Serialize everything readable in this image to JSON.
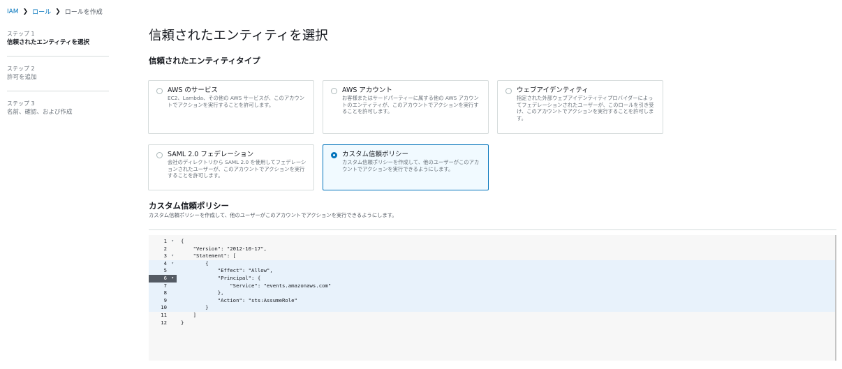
{
  "breadcrumb": {
    "items": [
      "IAM",
      "ロール",
      "ロールを作成"
    ]
  },
  "steps": [
    {
      "num": "ステップ 1",
      "title": "信頼されたエンティティを選択"
    },
    {
      "num": "ステップ 2",
      "title": "許可を追加"
    },
    {
      "num": "ステップ 3",
      "title": "名前、確認、および作成"
    }
  ],
  "page_title": "信頼されたエンティティを選択",
  "entity_type": {
    "heading": "信頼されたエンティティタイプ",
    "options": [
      {
        "title": "AWS のサービス",
        "desc": "EC2、Lambda、その他の AWS サービスが、このアカウントでアクションを実行することを許可します。",
        "selected": false
      },
      {
        "title": "AWS アカウント",
        "desc": "お客様またはサードパーティーに属する他の AWS アカウントのエンティティが、このアカウントでアクションを実行することを許可します。",
        "selected": false
      },
      {
        "title": "ウェブアイデンティティ",
        "desc": "指定された外部ウェブアイデンティティプロバイダーによってフェデレーションされたユーザーが、このロールを引き受け、このアカウントでアクションを実行することを許可します。",
        "selected": false
      },
      {
        "title": "SAML 2.0 フェデレーション",
        "desc": "会社のディレクトリから SAML 2.0 を使用してフェデレーションされたユーザーが、このアカウントでアクションを実行することを許可します。",
        "selected": false
      },
      {
        "title": "カスタム信頼ポリシー",
        "desc": "カスタム信頼ポリシーを作成して、他のユーザーがこのアカウントでアクションを実行できるようにします。",
        "selected": true
      }
    ]
  },
  "custom_policy": {
    "heading": "カスタム信頼ポリシー",
    "desc": "カスタム信頼ポリシーを作成して、他のユーザーがこのアカウントでアクションを実行できるようにします。"
  },
  "editor": {
    "active_line": 6,
    "lines": [
      {
        "n": "1",
        "fold": true,
        "text": "{"
      },
      {
        "n": "2",
        "fold": false,
        "text": "    \"Version\": \"2012-10-17\","
      },
      {
        "n": "3",
        "fold": true,
        "text": "    \"Statement\": ["
      },
      {
        "n": "4",
        "fold": true,
        "text": "        {"
      },
      {
        "n": "5",
        "fold": false,
        "text": "            \"Effect\": \"Allow\","
      },
      {
        "n": "6",
        "fold": true,
        "text": "            \"Principal\": {"
      },
      {
        "n": "7",
        "fold": false,
        "text": "                \"Service\": \"events.amazonaws.com\""
      },
      {
        "n": "8",
        "fold": false,
        "text": "            },"
      },
      {
        "n": "9",
        "fold": false,
        "text": "            \"Action\": \"sts:AssumeRole\""
      },
      {
        "n": "10",
        "fold": false,
        "text": "        }"
      },
      {
        "n": "11",
        "fold": false,
        "text": "    ]"
      },
      {
        "n": "12",
        "fold": false,
        "text": "}"
      }
    ]
  },
  "colors": {
    "accent": "#0073bb",
    "selected_bg": "#f1faff",
    "highlight_line": "#e8f2fb"
  }
}
